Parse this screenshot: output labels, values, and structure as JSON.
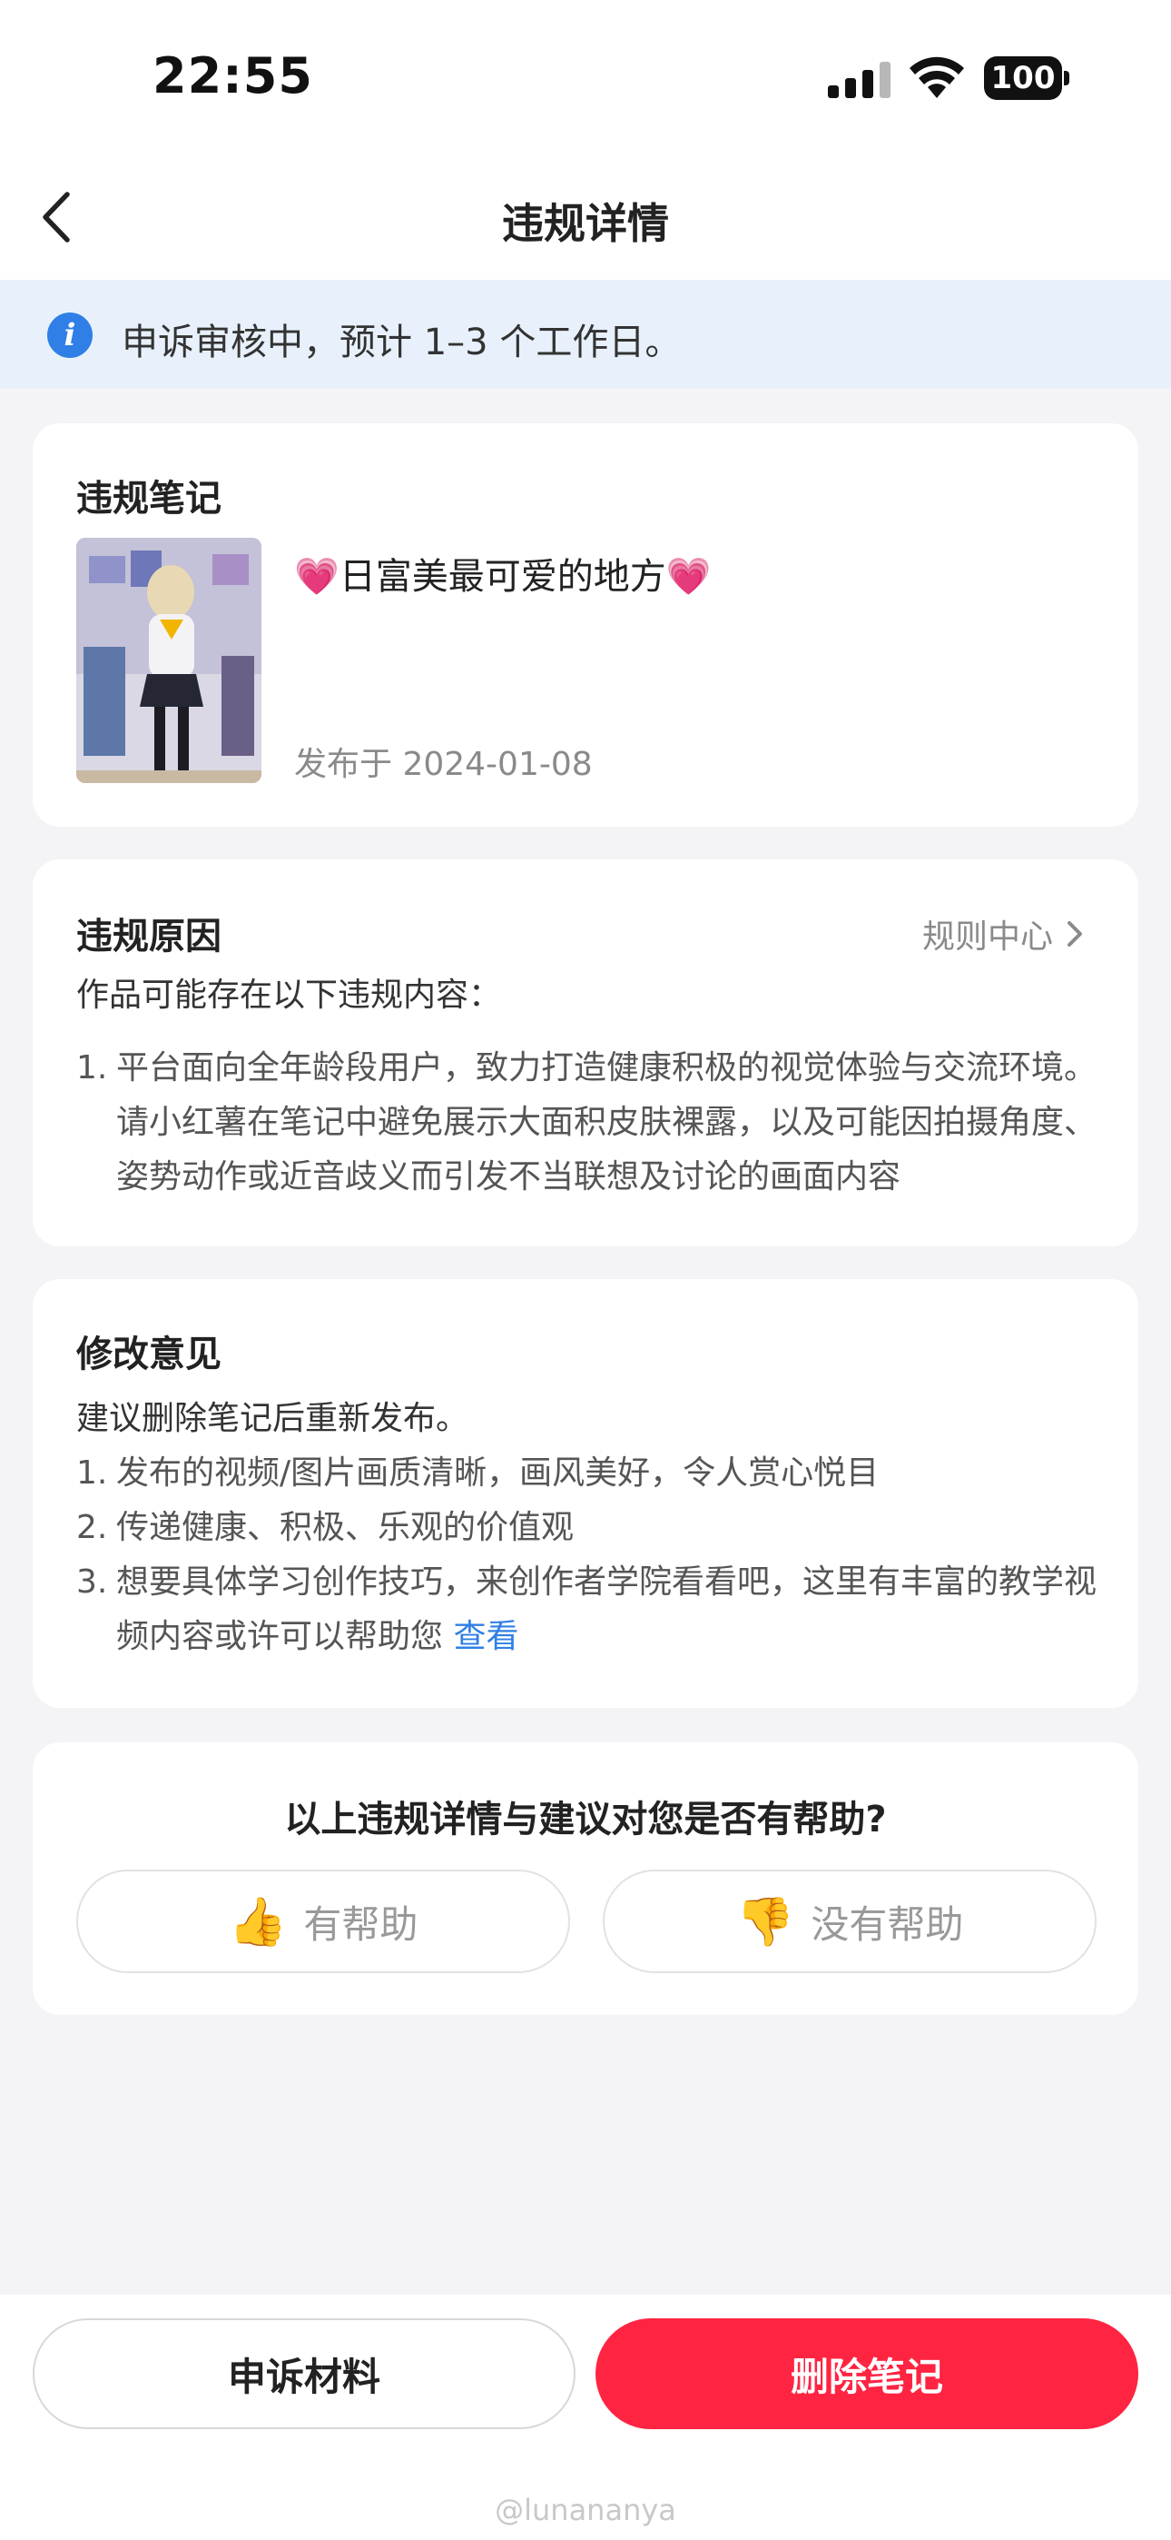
{
  "status_bar": {
    "time": "22:55",
    "battery": "100"
  },
  "nav": {
    "title": "违规详情"
  },
  "banner": {
    "text": "申诉审核中，预计 1–3 个工作日。"
  },
  "note_card": {
    "title": "违规笔记",
    "note_title": "日富美最可爱的地方",
    "heart": "💗",
    "published": "发布于 2024-01-08"
  },
  "reason_card": {
    "title": "违规原因",
    "rule_center": "规则中心",
    "intro": "作品可能存在以下违规内容：",
    "items": [
      {
        "num": "1.",
        "text": "平台面向全年龄段用户，致力打造健康积极的视觉体验与交流环境。请小红薯在笔记中避免展示大面积皮肤裸露，以及可能因拍摄角度、姿势动作或近音歧义而引发不当联想及讨论的画面内容"
      }
    ]
  },
  "suggest_card": {
    "title": "修改意见",
    "intro": "建议删除笔记后重新发布。",
    "items": [
      {
        "num": "1.",
        "text": "发布的视频/图片画质清晰，画风美好，令人赏心悦目"
      },
      {
        "num": "2.",
        "text": "传递健康、积极、乐观的价值观"
      },
      {
        "num": "3.",
        "text": "想要具体学习创作技巧，来创作者学院看看吧，这里有丰富的教学视频内容或许可以帮助您",
        "link": "查看"
      }
    ]
  },
  "feedback": {
    "question": "以上违规详情与建议对您是否有帮助?",
    "yes_label": "有帮助",
    "no_label": "没有帮助",
    "yes_emoji": "👍",
    "no_emoji": "👎"
  },
  "bottom": {
    "appeal_label": "申诉材料",
    "delete_label": "删除笔记",
    "watermark": "@lunananya"
  },
  "colors": {
    "accent_red": "#ff2442",
    "info_blue": "#2f7fe6",
    "banner_bg": "#e8f1fb"
  }
}
